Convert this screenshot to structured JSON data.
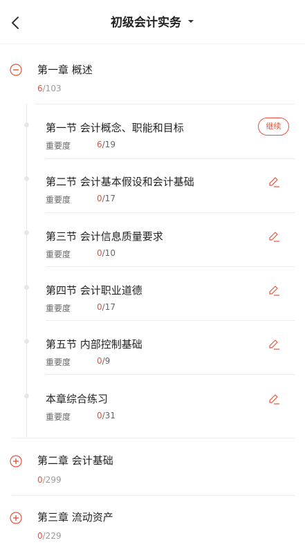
{
  "header": {
    "title": "初级会计实务",
    "back_icon": "chevron-left-icon",
    "dropdown_icon": "caret-down-icon"
  },
  "colors": {
    "accent": "#e8503a",
    "text": "#222222",
    "muted": "#999999"
  },
  "chapters": [
    {
      "title": "第一章 概述",
      "done": "6",
      "total": "/103",
      "expanded": true,
      "sections": [
        {
          "title": "第一节 会计概念、职能和目标",
          "importance_label": "重要度",
          "done": "6",
          "total": "/19",
          "action": "继续"
        },
        {
          "title": "第二节 会计基本假设和会计基础",
          "importance_label": "重要度",
          "done": "0",
          "total": "/17",
          "action_icon": "edit-pen-icon"
        },
        {
          "title": "第三节 会计信息质量要求",
          "importance_label": "重要度",
          "done": "0",
          "total": "/10",
          "action_icon": "edit-pen-icon"
        },
        {
          "title": "第四节 会计职业道德",
          "importance_label": "重要度",
          "done": "0",
          "total": "/17",
          "action_icon": "edit-pen-icon"
        },
        {
          "title": "第五节 内部控制基础",
          "importance_label": "重要度",
          "done": "0",
          "total": "/9",
          "action_icon": "edit-pen-icon"
        },
        {
          "title": "本章综合练习",
          "importance_label": "重要度",
          "done": "0",
          "total": "/31",
          "action_icon": "edit-pen-icon"
        }
      ]
    },
    {
      "title": "第二章 会计基础",
      "done": "0",
      "total": "/299",
      "expanded": false
    },
    {
      "title": "第三章 流动资产",
      "done": "0",
      "total": "/229",
      "expanded": false
    }
  ]
}
